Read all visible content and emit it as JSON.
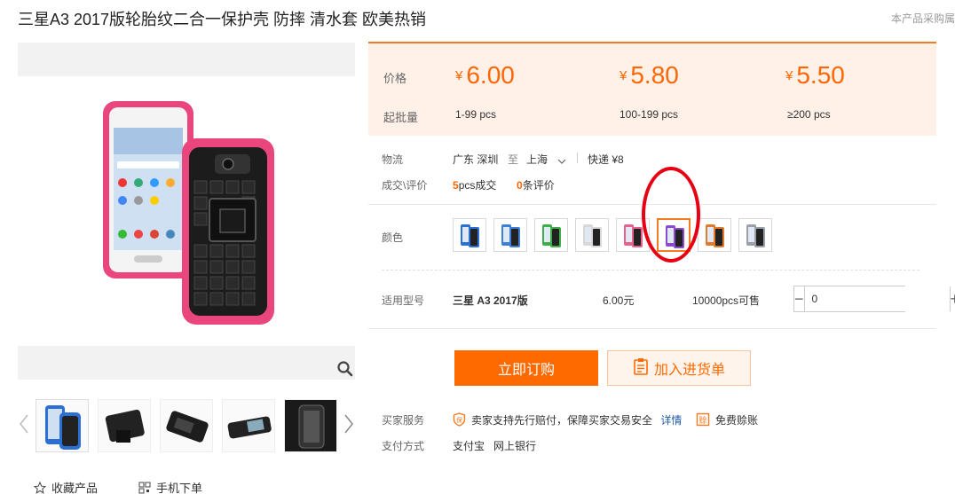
{
  "header": {
    "title": "三星A3 2017版轮胎纹二合一保护壳 防摔 清水套 欧美热销",
    "top_right": "本产品采购属"
  },
  "price": {
    "label_price": "价格",
    "label_moq": "起批量",
    "currency": "¥",
    "tiers": [
      {
        "price": "6.00",
        "range": "1-99 pcs"
      },
      {
        "price": "5.80",
        "range": "100-199 pcs"
      },
      {
        "price": "5.50",
        "range": "≥200 pcs"
      }
    ]
  },
  "logistics": {
    "label": "物流",
    "origin": "广东 深圳",
    "to": "至",
    "destination": "上海",
    "express": "快递 ¥8"
  },
  "deals": {
    "label": "成交\\评价",
    "sold_count": "5",
    "sold_text": "pcs成交",
    "review_count": "0",
    "review_text": "条评价"
  },
  "color": {
    "label": "颜色",
    "selected_index": 5,
    "swatch_accents": [
      "#2a6fd6",
      "#3d7ed8",
      "#3fae49",
      "#d8d8d8",
      "#e8618c",
      "#8a4bd0",
      "#e07a2c",
      "#9aa0a8"
    ]
  },
  "model": {
    "label": "适用型号",
    "name": "三星 A3 2017版",
    "price": "6.00元",
    "stock": "10000pcs可售",
    "quantity": "0"
  },
  "buttons": {
    "buy": "立即订购",
    "cart": "加入进货单"
  },
  "service": {
    "label": "买家服务",
    "guarantee": "卖家支持先行赔付，保障买家交易安全",
    "details": "详情",
    "free_bill": "免费赊账"
  },
  "payment": {
    "label": "支付方式",
    "methods": [
      "支付宝",
      "网上银行"
    ]
  },
  "bottom": {
    "favorite": "收藏产品",
    "mobile_order": "手机下单"
  },
  "colors": {
    "accent": "#ff6a00",
    "price_panel_bg": "#fff1e8",
    "case_pink": "#e8467c",
    "annotation_red": "#e60012"
  }
}
